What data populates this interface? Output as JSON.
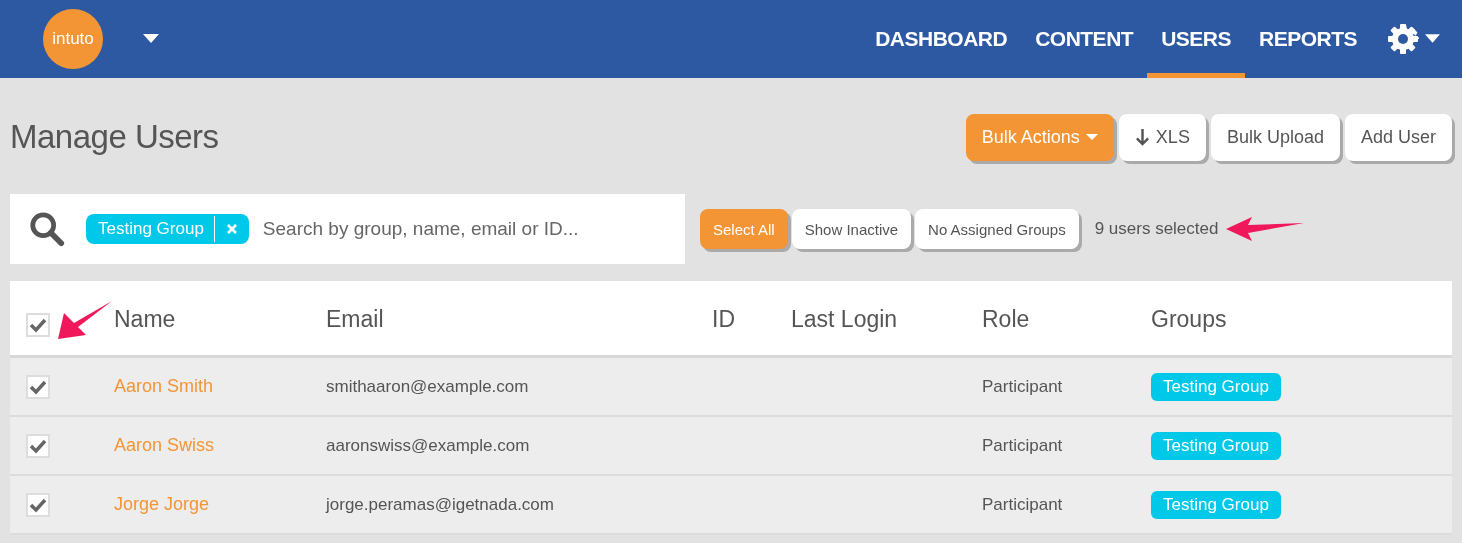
{
  "header": {
    "logo": "intuto",
    "nav": [
      {
        "label": "DASHBOARD",
        "selected": false
      },
      {
        "label": "CONTENT",
        "selected": false
      },
      {
        "label": "USERS",
        "selected": true
      },
      {
        "label": "REPORTS",
        "selected": false
      }
    ]
  },
  "page_title": "Manage Users",
  "actions": [
    {
      "label": "Bulk Actions",
      "kind": "primary-dropdown"
    },
    {
      "label": "XLS",
      "kind": "download"
    },
    {
      "label": "Bulk Upload",
      "kind": "plain"
    },
    {
      "label": "Add User",
      "kind": "plain"
    }
  ],
  "search": {
    "tags": [
      "Testing Group"
    ],
    "placeholder": "Search by group, name, email or ID..."
  },
  "filters": [
    {
      "label": "Select All",
      "selected": true
    },
    {
      "label": "Show Inactive",
      "selected": false
    },
    {
      "label": "No Assigned Groups",
      "selected": false
    }
  ],
  "selection_count": {
    "text": "9 users selected",
    "arrow": true
  },
  "table": {
    "all_checked": true,
    "header_arrow": true,
    "columns": [
      "Name",
      "Email",
      "ID",
      "Last Login",
      "Role",
      "Groups"
    ],
    "rows": [
      {
        "checked": true,
        "name": "Aaron Smith",
        "email": "smithaaron@example.com",
        "role": "Participant",
        "groups": [
          "Testing Group"
        ]
      },
      {
        "checked": true,
        "name": "Aaron Swiss",
        "email": "aaronswiss@example.com",
        "role": "Participant",
        "groups": [
          "Testing Group"
        ]
      },
      {
        "checked": true,
        "name": "Jorge Jorge",
        "email": "jorge.peramas@igetnada.com",
        "role": "Participant",
        "groups": [
          "Testing Group"
        ]
      }
    ]
  }
}
